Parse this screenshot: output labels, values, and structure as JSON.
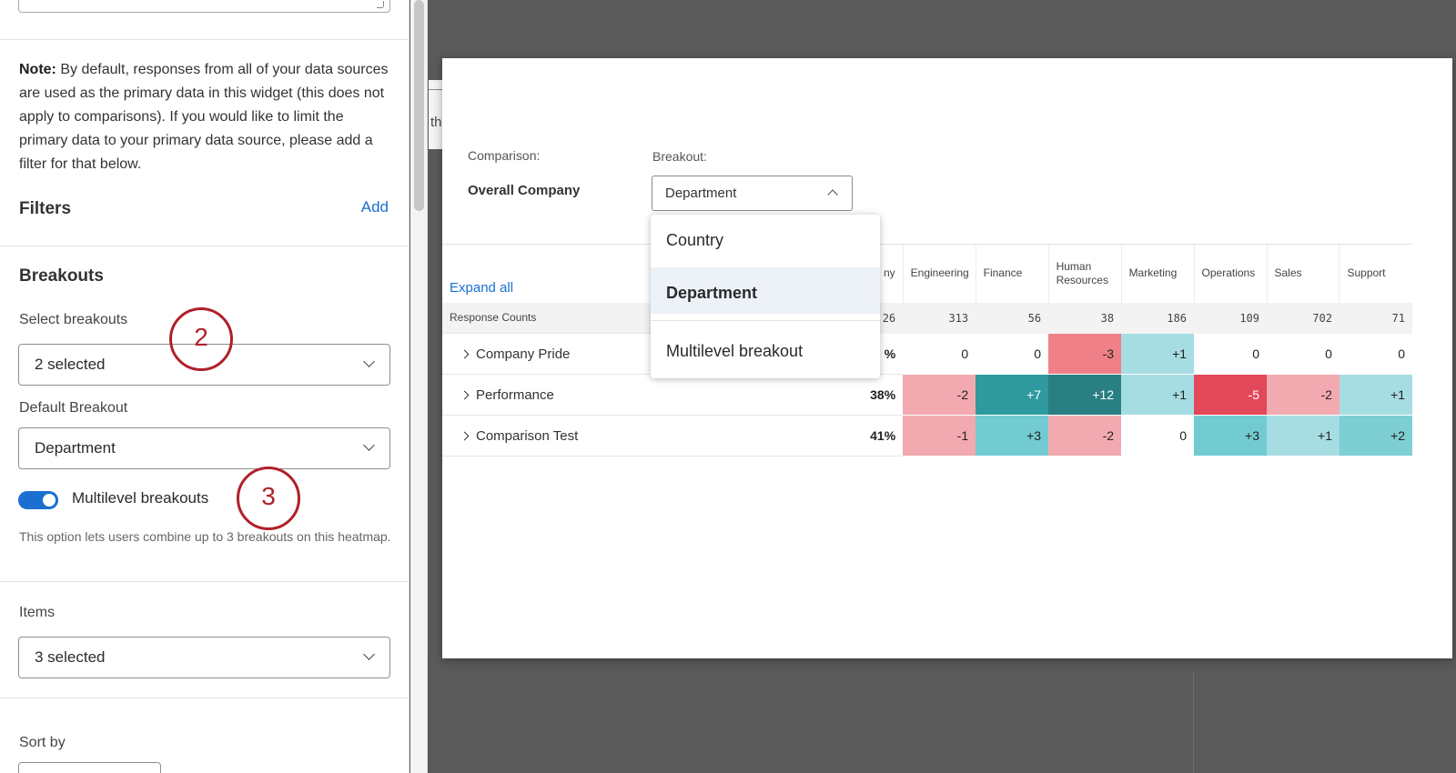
{
  "left_panel": {
    "note": {
      "label": "Note:",
      "text": " By default, responses from all of your data sources are used as the primary data in this widget (this does not apply to comparisons). If you would like to limit the primary data to your primary data source, please add a filter for that below."
    },
    "filters": {
      "title": "Filters",
      "add_label": "Add"
    },
    "breakouts": {
      "title": "Breakouts",
      "select_label": "Select breakouts",
      "select_value": "2 selected",
      "default_label": "Default Breakout",
      "default_value": "Department",
      "multilevel_label": "Multilevel breakouts",
      "multilevel_enabled": true,
      "help": "This option lets users combine up to 3 breakouts on this heatmap."
    },
    "items": {
      "label": "Items",
      "value": "3 selected"
    },
    "sort": {
      "label": "Sort by"
    },
    "callouts": [
      "2",
      "3"
    ]
  },
  "background": {
    "fragment_text": "th"
  },
  "modal": {
    "comparison_label": "Comparison:",
    "comparison_value": "Overall Company",
    "breakout_label": "Breakout:",
    "breakout_value": "Department",
    "dropdown_options": [
      "Country",
      "Department",
      "Multilevel breakout"
    ],
    "dropdown_selected": "Department",
    "expand_all": "Expand all",
    "overall_header_partial": "ny",
    "columns": [
      "Engineering",
      "Finance",
      "Human Resources",
      "Marketing",
      "Operations",
      "Sales",
      "Support"
    ],
    "counts_row": {
      "label": "Response Counts",
      "overall": "26",
      "values": [
        "313",
        "56",
        "38",
        "186",
        "109",
        "702",
        "71"
      ]
    },
    "rows": [
      {
        "label": "Company Pride",
        "overall": "%",
        "values": [
          "0",
          "0",
          "-3",
          "+1",
          "0",
          "0",
          "0"
        ]
      },
      {
        "label": "Performance",
        "overall": "38%",
        "values": [
          "-2",
          "+7",
          "+12",
          "+1",
          "-5",
          "-2",
          "+1"
        ]
      },
      {
        "label": "Comparison Test",
        "overall": "41%",
        "values": [
          "-1",
          "+3",
          "-2",
          "0",
          "+3",
          "+1",
          "+2"
        ]
      }
    ],
    "heat_colors": {
      "-5": "#e3475a",
      "-3": "#f08088",
      "-2": "#f2aab0",
      "-1": "#f2aab0",
      "0": "#ffffff",
      "+1": "#a6dde2",
      "+2": "#7dcfd4",
      "+3": "#72cbd1",
      "+7": "#2f9a9e",
      "+12": "#2a7f83"
    },
    "heat_text_colors": {
      "+7": "#ffffff",
      "+12": "#ffffff",
      "-5": "#ffffff"
    }
  }
}
